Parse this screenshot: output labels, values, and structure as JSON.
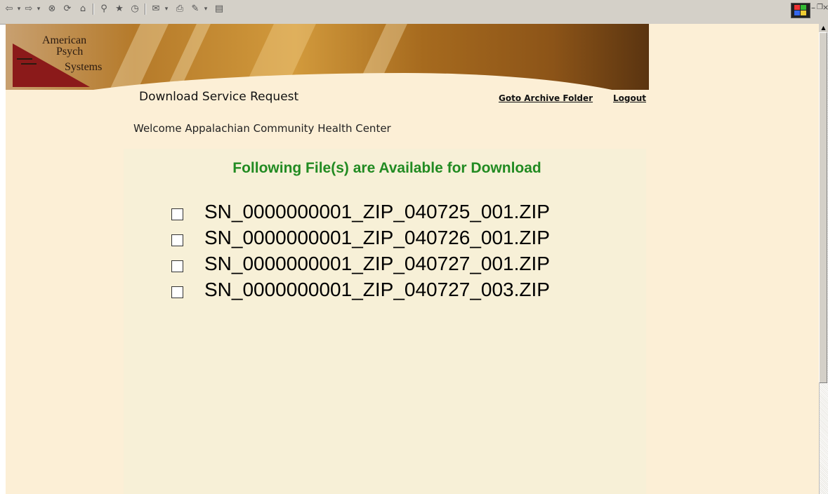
{
  "header": {
    "title": "Download Service Request",
    "links": [
      "Goto Archive Folder",
      "Logout"
    ]
  },
  "logo": {
    "lines": [
      "American",
      "Psych",
      "Systems"
    ]
  },
  "welcome": "Welcome Appalachian Community Health Center",
  "panel": {
    "heading": "Following File(s) are Available for Download",
    "files": [
      "SN_0000000001_ZIP_040725_001.ZIP",
      "SN_0000000001_ZIP_040726_001.ZIP",
      "SN_0000000001_ZIP_040727_001.ZIP",
      "SN_0000000001_ZIP_040727_003.ZIP"
    ]
  },
  "toolbar": {
    "icons": [
      "back-icon",
      "forward-icon",
      "stop-icon",
      "refresh-icon",
      "home-icon",
      "search-icon",
      "favorites-icon",
      "history-icon",
      "mail-icon",
      "print-icon",
      "edit-icon",
      "discuss-icon"
    ]
  },
  "colors": {
    "page_bg": "#fcefd6",
    "panel_bg": "#f7f0d7",
    "heading_green": "#228b22",
    "logo_red": "#8b1a1a"
  }
}
